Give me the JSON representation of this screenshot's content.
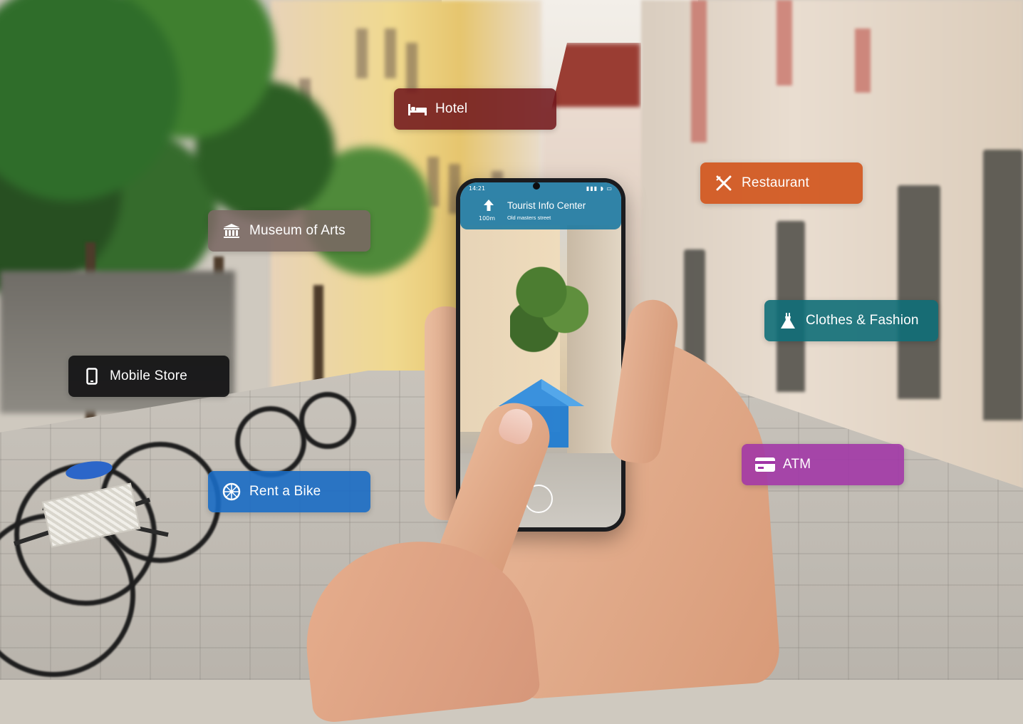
{
  "phone": {
    "status_time": "14:21",
    "navigation": {
      "title": "Tourist Info Center",
      "street": "Old masters street",
      "distance": "100m",
      "icon": "up-arrow-icon"
    }
  },
  "tags": {
    "hotel": {
      "label": "Hotel",
      "icon": "bed-icon",
      "color": "#72181c"
    },
    "museum": {
      "label": "Museum of Arts",
      "icon": "museum-icon",
      "color": "#7a6863"
    },
    "restaurant": {
      "label": "Restaurant",
      "icon": "cutlery-icon",
      "color": "#d05016"
    },
    "clothes": {
      "label": "Clothes & Fashion",
      "icon": "dress-icon",
      "color": "#106e78"
    },
    "mobile": {
      "label": "Mobile Store",
      "icon": "smartphone-icon",
      "color": "#121214"
    },
    "bike": {
      "label": "Rent a Bike",
      "icon": "bike-wheel-icon",
      "color": "#1a6cc4"
    },
    "atm": {
      "label": "ATM",
      "icon": "credit-card-icon",
      "color": "#a034a6"
    }
  }
}
